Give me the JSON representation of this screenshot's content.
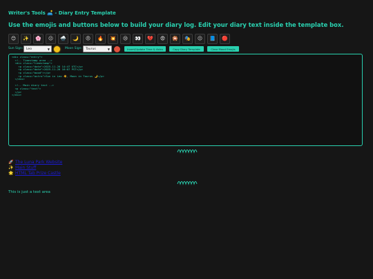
{
  "header": {
    "title": "Writer's Tools 🛋️ - Diary Entry Template",
    "subtitle": "Use the emojis and buttons below to build your diary log. Edit your diary text inside the template box."
  },
  "emoji_bar": [
    {
      "glyph": "😊",
      "name": "smile-emoji-button"
    },
    {
      "glyph": "✨",
      "name": "sparkles-emoji-button"
    },
    {
      "glyph": "🌸",
      "name": "blossom-emoji-button"
    },
    {
      "glyph": "😐",
      "name": "neutral-face-emoji-button"
    },
    {
      "glyph": "🌧️",
      "name": "rain-cloud-emoji-button"
    },
    {
      "glyph": "🌙",
      "name": "crescent-moon-emoji-button"
    },
    {
      "glyph": "😠",
      "name": "angry-face-emoji-button"
    },
    {
      "glyph": "🔥",
      "name": "fire-emoji-button"
    },
    {
      "glyph": "💥",
      "name": "collision-emoji-button"
    },
    {
      "glyph": "😢",
      "name": "crying-face-emoji-button"
    },
    {
      "glyph": "👀",
      "name": "eyes-emoji-button"
    },
    {
      "glyph": "💔",
      "name": "broken-heart-emoji-button"
    },
    {
      "glyph": "😨",
      "name": "fearful-face-emoji-button"
    },
    {
      "glyph": "🎇",
      "name": "fireworks-emoji-button"
    },
    {
      "glyph": "🎭",
      "name": "theater-masks-emoji-button"
    },
    {
      "glyph": "😐",
      "name": "neutral-face-2-emoji-button"
    },
    {
      "glyph": "📘",
      "name": "blue-book-emoji-button"
    },
    {
      "glyph": "🔴",
      "name": "red-circle-emoji-button"
    }
  ],
  "controls": {
    "sun_sign_label": "Sun Sign:",
    "sun_sign_value": "Leo",
    "moon_sign_label": "Moon Sign:",
    "moon_sign_value": "Taurus",
    "insert_button": "Insert/Update Time & Astro",
    "copy_button": "Copy Diary Template",
    "clear_button": "Clear Mood Emojis",
    "sun_color": "#f3c11a",
    "moon_color": "#e0523e"
  },
  "editor": {
    "content": "<div class=\"entry\">\n  <!-- Timestamp area -->\n  <div class=\"timestamp\">\n    <p class=\"date\">2025-11-26 14:47 UTC</p>\n    <p class=\"date\">2025-11-26 16:07 PST</p>\n    <p class=\"mood\"></p>\n    <p class=\"astro\">Sun in Leo ☀️, Moon in Taurus 🌙</p>\n  </div>\n\n  <!-- Main diary text -->\n  <p class=\"text\">\n  </p>\n</div>"
  },
  "links": [
    {
      "icon": "🚀",
      "label": "The Luna Park Website"
    },
    {
      "icon": "✨",
      "label": "Main Stuff"
    },
    {
      "icon": "🌟",
      "label": "HTML Tab Prize Castle"
    }
  ],
  "textarea_note": "This is just a text area",
  "colors": {
    "accent": "#2ad1b0",
    "background": "#161616",
    "link": "#1b1bd6"
  }
}
